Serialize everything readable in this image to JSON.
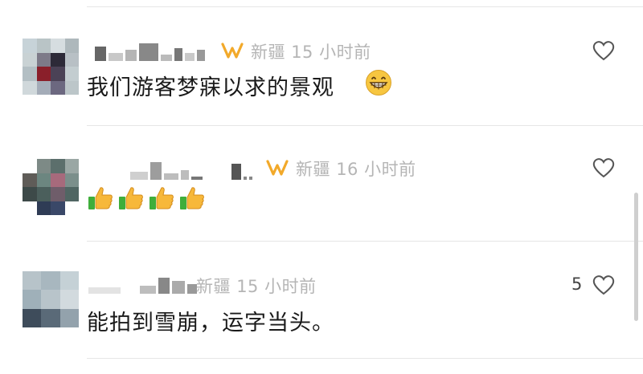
{
  "comments": [
    {
      "location": "新疆",
      "time": "15 小时前",
      "text": "我们游客梦寐以求的景观",
      "trailing_emoji": "grinning-face",
      "likes": ""
    },
    {
      "location": "新疆",
      "time": "16 小时前",
      "text": "",
      "emoji": [
        "thumbs-up",
        "thumbs-up",
        "thumbs-up",
        "thumbs-up"
      ],
      "likes": ""
    },
    {
      "location": "新疆",
      "time": "15 小时前",
      "text": "能拍到雪崩，运字当头。",
      "likes": "5"
    }
  ],
  "colors": {
    "meta_text": "#b5b5b5",
    "badge": "#f2a92a",
    "body_text": "#1a1a1a",
    "divider": "#e6e6e6"
  },
  "icons": {
    "badge": "vip-badge-icon",
    "like": "heart-outline-icon"
  }
}
